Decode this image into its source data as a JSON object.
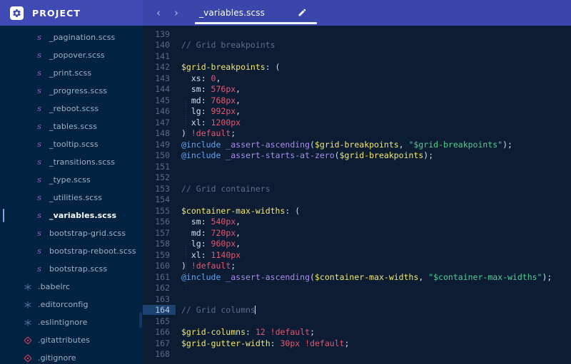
{
  "window": {
    "brand_title": "PROJECT",
    "logo_icon": "gear-icon"
  },
  "tabbar": {
    "back_icon": "chevron-left-icon",
    "back_glyph": "‹",
    "forward_icon": "chevron-right-icon",
    "forward_glyph": "›",
    "active_tab": "_variables.scss",
    "edit_icon": "pencil-icon"
  },
  "sidebar": {
    "files": [
      {
        "name": "_pagination.scss",
        "icon": "sass-icon",
        "level": "nested",
        "active": false
      },
      {
        "name": "_popover.scss",
        "icon": "sass-icon",
        "level": "nested",
        "active": false
      },
      {
        "name": "_print.scss",
        "icon": "sass-icon",
        "level": "nested",
        "active": false
      },
      {
        "name": "_progress.scss",
        "icon": "sass-icon",
        "level": "nested",
        "active": false
      },
      {
        "name": "_reboot.scss",
        "icon": "sass-icon",
        "level": "nested",
        "active": false
      },
      {
        "name": "_tables.scss",
        "icon": "sass-icon",
        "level": "nested",
        "active": false
      },
      {
        "name": "_tooltip.scss",
        "icon": "sass-icon",
        "level": "nested",
        "active": false
      },
      {
        "name": "_transitions.scss",
        "icon": "sass-icon",
        "level": "nested",
        "active": false
      },
      {
        "name": "_type.scss",
        "icon": "sass-icon",
        "level": "nested",
        "active": false
      },
      {
        "name": "_utilities.scss",
        "icon": "sass-icon",
        "level": "nested",
        "active": false
      },
      {
        "name": "_variables.scss",
        "icon": "sass-icon",
        "level": "nested",
        "active": true
      },
      {
        "name": "bootstrap-grid.scss",
        "icon": "sass-icon",
        "level": "nested",
        "active": false
      },
      {
        "name": "bootstrap-reboot.scss",
        "icon": "sass-icon",
        "level": "nested",
        "active": false
      },
      {
        "name": "bootstrap.scss",
        "icon": "sass-icon",
        "level": "nested",
        "active": false
      },
      {
        "name": ".babelrc",
        "icon": "asterisk-icon",
        "level": "root",
        "active": false
      },
      {
        "name": ".editorconfig",
        "icon": "asterisk-icon",
        "level": "root",
        "active": false
      },
      {
        "name": ".eslintignore",
        "icon": "asterisk-icon",
        "level": "root",
        "active": false
      },
      {
        "name": ".gitattributes",
        "icon": "git-icon",
        "level": "root",
        "active": false
      },
      {
        "name": ".gitignore",
        "icon": "git-icon",
        "level": "root",
        "active": false
      }
    ]
  },
  "editor": {
    "file": "_variables.scss",
    "active_line": 164,
    "first_line": 139,
    "last_line": 168,
    "lines": [
      {
        "n": 139,
        "tokens": []
      },
      {
        "n": 140,
        "tokens": [
          {
            "t": "comment",
            "s": "// Grid breakpoints"
          }
        ]
      },
      {
        "n": 141,
        "tokens": []
      },
      {
        "n": 142,
        "tokens": [
          {
            "t": "var",
            "s": "$grid-breakpoints"
          },
          {
            "t": "punct",
            "s": ": ("
          }
        ]
      },
      {
        "n": 143,
        "tokens": [
          {
            "t": "key",
            "s": "  xs: "
          },
          {
            "t": "num",
            "s": "0"
          },
          {
            "t": "punct",
            "s": ","
          }
        ]
      },
      {
        "n": 144,
        "tokens": [
          {
            "t": "key",
            "s": "  sm: "
          },
          {
            "t": "num",
            "s": "576px"
          },
          {
            "t": "punct",
            "s": ","
          }
        ]
      },
      {
        "n": 145,
        "tokens": [
          {
            "t": "key",
            "s": "  md: "
          },
          {
            "t": "num",
            "s": "768px"
          },
          {
            "t": "punct",
            "s": ","
          }
        ]
      },
      {
        "n": 146,
        "tokens": [
          {
            "t": "key",
            "s": "  lg: "
          },
          {
            "t": "num",
            "s": "992px"
          },
          {
            "t": "punct",
            "s": ","
          }
        ]
      },
      {
        "n": 147,
        "tokens": [
          {
            "t": "key",
            "s": "  xl: "
          },
          {
            "t": "num",
            "s": "1200px"
          }
        ]
      },
      {
        "n": 148,
        "tokens": [
          {
            "t": "punct",
            "s": ") "
          },
          {
            "t": "default",
            "s": "!default"
          },
          {
            "t": "punct",
            "s": ";"
          }
        ]
      },
      {
        "n": 149,
        "tokens": [
          {
            "t": "at",
            "s": "@include"
          },
          {
            "t": "punct",
            "s": " "
          },
          {
            "t": "mixin",
            "s": "_assert-ascending"
          },
          {
            "t": "punct",
            "s": "("
          },
          {
            "t": "var",
            "s": "$grid-breakpoints"
          },
          {
            "t": "punct",
            "s": ", "
          },
          {
            "t": "string",
            "s": "\"$grid-breakpoints\""
          },
          {
            "t": "punct",
            "s": ");"
          }
        ]
      },
      {
        "n": 150,
        "tokens": [
          {
            "t": "at",
            "s": "@include"
          },
          {
            "t": "punct",
            "s": " "
          },
          {
            "t": "mixin",
            "s": "_assert-starts-at-zero"
          },
          {
            "t": "punct",
            "s": "("
          },
          {
            "t": "var",
            "s": "$grid-breakpoints"
          },
          {
            "t": "punct",
            "s": ");"
          }
        ]
      },
      {
        "n": 151,
        "tokens": []
      },
      {
        "n": 152,
        "tokens": []
      },
      {
        "n": 153,
        "tokens": [
          {
            "t": "comment",
            "s": "// Grid containers"
          }
        ]
      },
      {
        "n": 154,
        "tokens": []
      },
      {
        "n": 155,
        "tokens": [
          {
            "t": "var",
            "s": "$container-max-widths"
          },
          {
            "t": "punct",
            "s": ": ("
          }
        ]
      },
      {
        "n": 156,
        "tokens": [
          {
            "t": "key",
            "s": "  sm: "
          },
          {
            "t": "num",
            "s": "540px"
          },
          {
            "t": "punct",
            "s": ","
          }
        ]
      },
      {
        "n": 157,
        "tokens": [
          {
            "t": "key",
            "s": "  md: "
          },
          {
            "t": "num",
            "s": "720px"
          },
          {
            "t": "punct",
            "s": ","
          }
        ]
      },
      {
        "n": 158,
        "tokens": [
          {
            "t": "key",
            "s": "  lg: "
          },
          {
            "t": "num",
            "s": "960px"
          },
          {
            "t": "punct",
            "s": ","
          }
        ]
      },
      {
        "n": 159,
        "tokens": [
          {
            "t": "key",
            "s": "  xl: "
          },
          {
            "t": "num",
            "s": "1140px"
          }
        ]
      },
      {
        "n": 160,
        "tokens": [
          {
            "t": "punct",
            "s": ") "
          },
          {
            "t": "default",
            "s": "!default"
          },
          {
            "t": "punct",
            "s": ";"
          }
        ]
      },
      {
        "n": 161,
        "tokens": [
          {
            "t": "at",
            "s": "@include"
          },
          {
            "t": "punct",
            "s": " "
          },
          {
            "t": "mixin",
            "s": "_assert-ascending"
          },
          {
            "t": "punct",
            "s": "("
          },
          {
            "t": "var",
            "s": "$container-max-widths"
          },
          {
            "t": "punct",
            "s": ", "
          },
          {
            "t": "string",
            "s": "\"$container-max-widths\""
          },
          {
            "t": "punct",
            "s": ");"
          }
        ]
      },
      {
        "n": 162,
        "tokens": []
      },
      {
        "n": 163,
        "tokens": []
      },
      {
        "n": 164,
        "tokens": [
          {
            "t": "comment",
            "s": "// Grid columns"
          }
        ],
        "caret": true
      },
      {
        "n": 165,
        "tokens": []
      },
      {
        "n": 166,
        "tokens": [
          {
            "t": "var",
            "s": "$grid-columns"
          },
          {
            "t": "punct",
            "s": ": "
          },
          {
            "t": "num",
            "s": "12"
          },
          {
            "t": "punct",
            "s": " "
          },
          {
            "t": "default",
            "s": "!default"
          },
          {
            "t": "punct",
            "s": ";"
          }
        ]
      },
      {
        "n": 167,
        "tokens": [
          {
            "t": "var",
            "s": "$grid-gutter-width"
          },
          {
            "t": "punct",
            "s": ": "
          },
          {
            "t": "num",
            "s": "30px"
          },
          {
            "t": "punct",
            "s": " "
          },
          {
            "t": "default",
            "s": "!default"
          },
          {
            "t": "punct",
            "s": ";"
          }
        ]
      },
      {
        "n": 168,
        "tokens": []
      }
    ]
  },
  "colors": {
    "brand_bar": "#3f4ab4",
    "tabbar": "#3b46ab",
    "sidebar_bg": "#022241",
    "editor_bg": "#0c1c33",
    "accent": "#8f9ce8",
    "active_line_gutter": "#1c4272",
    "sass_icon": "#a86fd6",
    "git_icon": "#d9415f",
    "asterisk_icon": "#4a6d95",
    "syntax_comment": "#5c6f86",
    "syntax_variable": "#f3e96b",
    "syntax_number": "#e8576f",
    "syntax_string": "#4fcf93",
    "syntax_mixin": "#a98cf0",
    "syntax_at": "#61a5f2",
    "syntax_punct": "#d7dfe9"
  }
}
